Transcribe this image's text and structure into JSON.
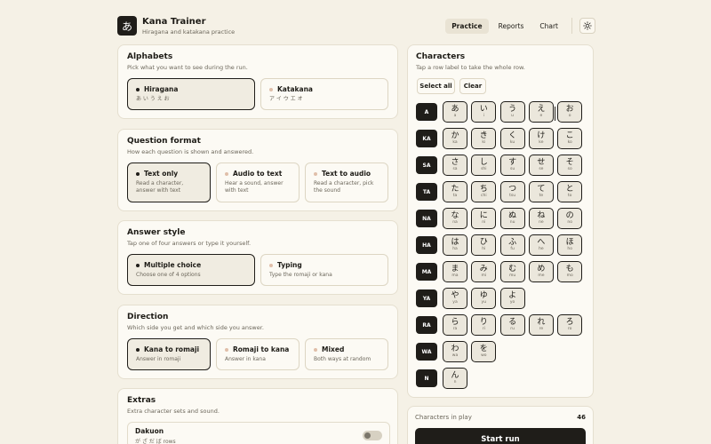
{
  "app": {
    "logo_glyph": "あ",
    "title": "Kana Trainer",
    "subtitle": "Hiragana and katakana practice"
  },
  "nav": {
    "tabs": [
      {
        "label": "Practice",
        "active": true
      },
      {
        "label": "Reports",
        "active": false
      },
      {
        "label": "Chart",
        "active": false
      }
    ],
    "theme_icon": "sun-icon"
  },
  "alphabets": {
    "title": "Alphabets",
    "description": "Pick what you want to see during the run.",
    "options": [
      {
        "label": "Hiragana",
        "sub": "あ い う え お",
        "selected": true
      },
      {
        "label": "Katakana",
        "sub": "ア イ ウ エ オ",
        "selected": false
      }
    ]
  },
  "question_format": {
    "title": "Question format",
    "description": "How each question is shown and answered.",
    "options": [
      {
        "label": "Text only",
        "sub": "Read a character, answer with text",
        "selected": true
      },
      {
        "label": "Audio to text",
        "sub": "Hear a sound, answer with text",
        "selected": false
      },
      {
        "label": "Text to audio",
        "sub": "Read a character, pick the sound",
        "selected": false
      }
    ]
  },
  "answer_style": {
    "title": "Answer style",
    "description": "Tap one of four answers or type it yourself.",
    "options": [
      {
        "label": "Multiple choice",
        "sub": "Choose one of 4 options",
        "selected": true
      },
      {
        "label": "Typing",
        "sub": "Type the romaji or kana",
        "selected": false
      }
    ]
  },
  "direction": {
    "title": "Direction",
    "description": "Which side you get and which side you answer.",
    "options": [
      {
        "label": "Kana to romaji",
        "sub": "Answer in romaji",
        "selected": true
      },
      {
        "label": "Romaji to kana",
        "sub": "Answer in kana",
        "selected": false
      },
      {
        "label": "Mixed",
        "sub": "Both ways at random",
        "selected": false
      }
    ]
  },
  "extras": {
    "title": "Extras",
    "description": "Extra character sets and sound.",
    "items": [
      {
        "label": "Dakuon",
        "sub": "が ざ だ ば rows",
        "enabled": false
      }
    ]
  },
  "characters": {
    "title": "Characters",
    "description": "Tap a row label to take the whole row.",
    "select_all": "Select all",
    "clear": "Clear",
    "rows": [
      {
        "label": "A",
        "cells": [
          [
            "あ",
            "a"
          ],
          [
            "い",
            "i"
          ],
          [
            "う",
            "u"
          ],
          [
            "え",
            "e"
          ],
          [
            "お",
            "o"
          ]
        ]
      },
      {
        "label": "KA",
        "cells": [
          [
            "か",
            "ka"
          ],
          [
            "き",
            "ki"
          ],
          [
            "く",
            "ku"
          ],
          [
            "け",
            "ke"
          ],
          [
            "こ",
            "ko"
          ]
        ]
      },
      {
        "label": "SA",
        "cells": [
          [
            "さ",
            "sa"
          ],
          [
            "し",
            "shi"
          ],
          [
            "す",
            "su"
          ],
          [
            "せ",
            "se"
          ],
          [
            "そ",
            "so"
          ]
        ]
      },
      {
        "label": "TA",
        "cells": [
          [
            "た",
            "ta"
          ],
          [
            "ち",
            "chi"
          ],
          [
            "つ",
            "tsu"
          ],
          [
            "て",
            "te"
          ],
          [
            "と",
            "to"
          ]
        ]
      },
      {
        "label": "NA",
        "cells": [
          [
            "な",
            "na"
          ],
          [
            "に",
            "ni"
          ],
          [
            "ぬ",
            "nu"
          ],
          [
            "ね",
            "ne"
          ],
          [
            "の",
            "no"
          ]
        ]
      },
      {
        "label": "HA",
        "cells": [
          [
            "は",
            "ha"
          ],
          [
            "ひ",
            "hi"
          ],
          [
            "ふ",
            "fu"
          ],
          [
            "へ",
            "he"
          ],
          [
            "ほ",
            "ho"
          ]
        ]
      },
      {
        "label": "MA",
        "cells": [
          [
            "ま",
            "ma"
          ],
          [
            "み",
            "mi"
          ],
          [
            "む",
            "mu"
          ],
          [
            "め",
            "me"
          ],
          [
            "も",
            "mo"
          ]
        ]
      },
      {
        "label": "YA",
        "cells": [
          [
            "や",
            "ya"
          ],
          [
            "ゆ",
            "yu"
          ],
          [
            "よ",
            "yo"
          ]
        ]
      },
      {
        "label": "RA",
        "cells": [
          [
            "ら",
            "ra"
          ],
          [
            "り",
            "ri"
          ],
          [
            "る",
            "ru"
          ],
          [
            "れ",
            "re"
          ],
          [
            "ろ",
            "ro"
          ]
        ]
      },
      {
        "label": "WA",
        "cells": [
          [
            "わ",
            "wa"
          ],
          [
            "を",
            "wo"
          ]
        ]
      },
      {
        "label": "N",
        "cells": [
          [
            "ん",
            "n"
          ]
        ]
      }
    ]
  },
  "play": {
    "label": "Characters in play",
    "count": "46",
    "start_label": "Start run"
  },
  "colors": {
    "background": "#f5f1e6",
    "card": "#fcfaf4",
    "ink": "#1f1d19",
    "accent_dot": "#e0bfa9"
  }
}
